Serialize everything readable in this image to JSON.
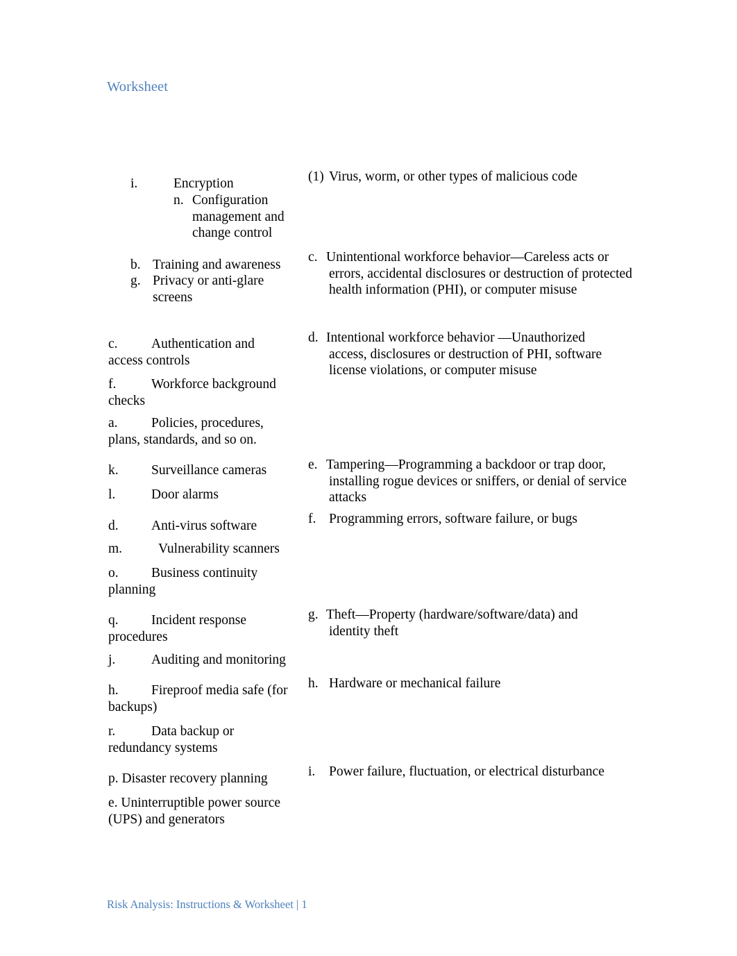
{
  "document": {
    "heading": "Worksheet",
    "footer": "Risk Analysis: Instructions & Worksheet | 1",
    "accent_color": "#4f81bd",
    "text_color": "#000000",
    "background_color": "#ffffff",
    "page_number": "1"
  },
  "left_column": {
    "items": [
      {
        "marker": "i.",
        "text": "Encryption"
      },
      {
        "marker": "n.",
        "text": "Configuration management and change control"
      },
      {
        "marker": "b.",
        "text": "Training and awareness"
      },
      {
        "marker": "g.",
        "text": "Privacy or anti-glare screens"
      },
      {
        "marker": "c.",
        "text": "Authentication and access controls"
      },
      {
        "marker": "f.",
        "text": "Workforce background checks"
      },
      {
        "marker": "a.",
        "text": "Policies, procedures, plans, standards, and so on."
      },
      {
        "marker": "k.",
        "text": "Surveillance cameras"
      },
      {
        "marker": "l.",
        "text": "Door alarms"
      },
      {
        "marker": "d.",
        "text": "Anti-virus software"
      },
      {
        "marker": "m.",
        "text": "Vulnerability scanners"
      },
      {
        "marker": "o.",
        "text": "Business continuity planning"
      },
      {
        "marker": "q.",
        "text": "Incident response procedures"
      },
      {
        "marker": "j.",
        "text": "Auditing and monitoring"
      },
      {
        "marker": "h.",
        "text": "Fireproof media safe (for backups)"
      },
      {
        "marker": "r.",
        "text": "Data backup or redundancy systems"
      },
      {
        "marker": "p.",
        "text": "Disaster recovery planning"
      },
      {
        "marker": "e.",
        "text": "Uninterruptible power source (UPS) and generators"
      }
    ]
  },
  "right_column": {
    "items": [
      {
        "marker": "(1)",
        "text": "Virus, worm, or other types of malicious code"
      },
      {
        "marker": "c.",
        "text": "Unintentional workforce behavior—Careless acts or errors, accidental disclosures or destruction of protected health information (PHI), or computer misuse"
      },
      {
        "marker": "d.",
        "text": "Intentional workforce behavior —Unauthorized access, disclosures or destruction of PHI, software license violations, or computer misuse"
      },
      {
        "marker": "e.",
        "text": "Tampering—Programming a backdoor or trap door, installing rogue devices or sniffers, or denial of service attacks"
      },
      {
        "marker": "f.",
        "text": "Programming errors, software failure, or bugs"
      },
      {
        "marker": "g.",
        "text": "Theft—Property (hardware/software/data) and identity theft"
      },
      {
        "marker": "h.",
        "text": "Hardware or mechanical failure"
      },
      {
        "marker": "i.",
        "text": "Power failure, fluctuation, or electrical disturbance"
      }
    ]
  }
}
